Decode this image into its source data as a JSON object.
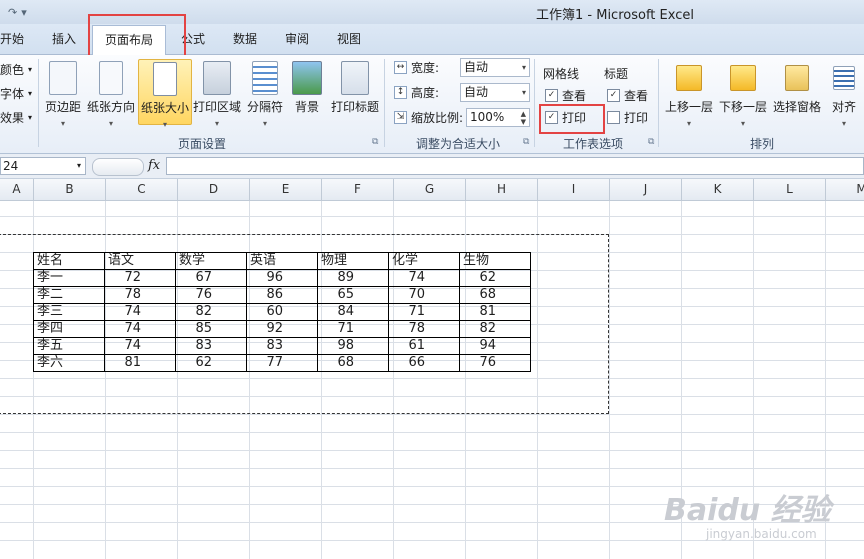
{
  "window": {
    "title": "工作簿1 - Microsoft Excel",
    "qat_symbols": "↶ ▾ ⋮"
  },
  "tabs": [
    "开始",
    "插入",
    "页面布局",
    "公式",
    "数据",
    "审阅",
    "视图"
  ],
  "active_tab": "页面布局",
  "left_cut": {
    "colors": "颜色",
    "fonts": "字体",
    "effects": "效果"
  },
  "page_setup": {
    "buttons": [
      "页边距",
      "纸张方向",
      "纸张大小",
      "打印区域",
      "分隔符",
      "背景",
      "打印标题"
    ],
    "label": "页面设置"
  },
  "scale_to_fit": {
    "width_label": "宽度:",
    "width_value": "自动",
    "height_label": "高度:",
    "height_value": "自动",
    "scale_label": "缩放比例:",
    "scale_value": "100%",
    "label": "调整为合适大小"
  },
  "sheet_options": {
    "gridlines": "网格线",
    "headings": "标题",
    "view": "查看",
    "print": "打印",
    "gridlines_view": true,
    "gridlines_print": true,
    "headings_view": true,
    "headings_print": false,
    "label": "工作表选项"
  },
  "arrange": {
    "buttons": [
      "上移一层",
      "下移一层",
      "选择窗格",
      "对齐"
    ],
    "label": "排列"
  },
  "formula_bar": {
    "name_box": "24",
    "fx": "fx",
    "value": ""
  },
  "columns": [
    "A",
    "B",
    "C",
    "D",
    "E",
    "F",
    "G",
    "H",
    "I",
    "J",
    "K",
    "L",
    "M"
  ],
  "table": {
    "headers": [
      "姓名",
      "语文",
      "数学",
      "英语",
      "物理",
      "化学",
      "生物"
    ],
    "rows": [
      [
        "李一",
        "72",
        "67",
        "96",
        "89",
        "74",
        "62"
      ],
      [
        "李二",
        "78",
        "76",
        "86",
        "65",
        "70",
        "68"
      ],
      [
        "李三",
        "74",
        "82",
        "60",
        "84",
        "71",
        "81"
      ],
      [
        "李四",
        "74",
        "85",
        "92",
        "71",
        "78",
        "82"
      ],
      [
        "李五",
        "74",
        "83",
        "83",
        "98",
        "61",
        "94"
      ],
      [
        "李六",
        "81",
        "62",
        "77",
        "68",
        "66",
        "76"
      ]
    ]
  },
  "watermark": {
    "brand": "Baidu 经验",
    "url": "jingyan.baidu.com"
  }
}
